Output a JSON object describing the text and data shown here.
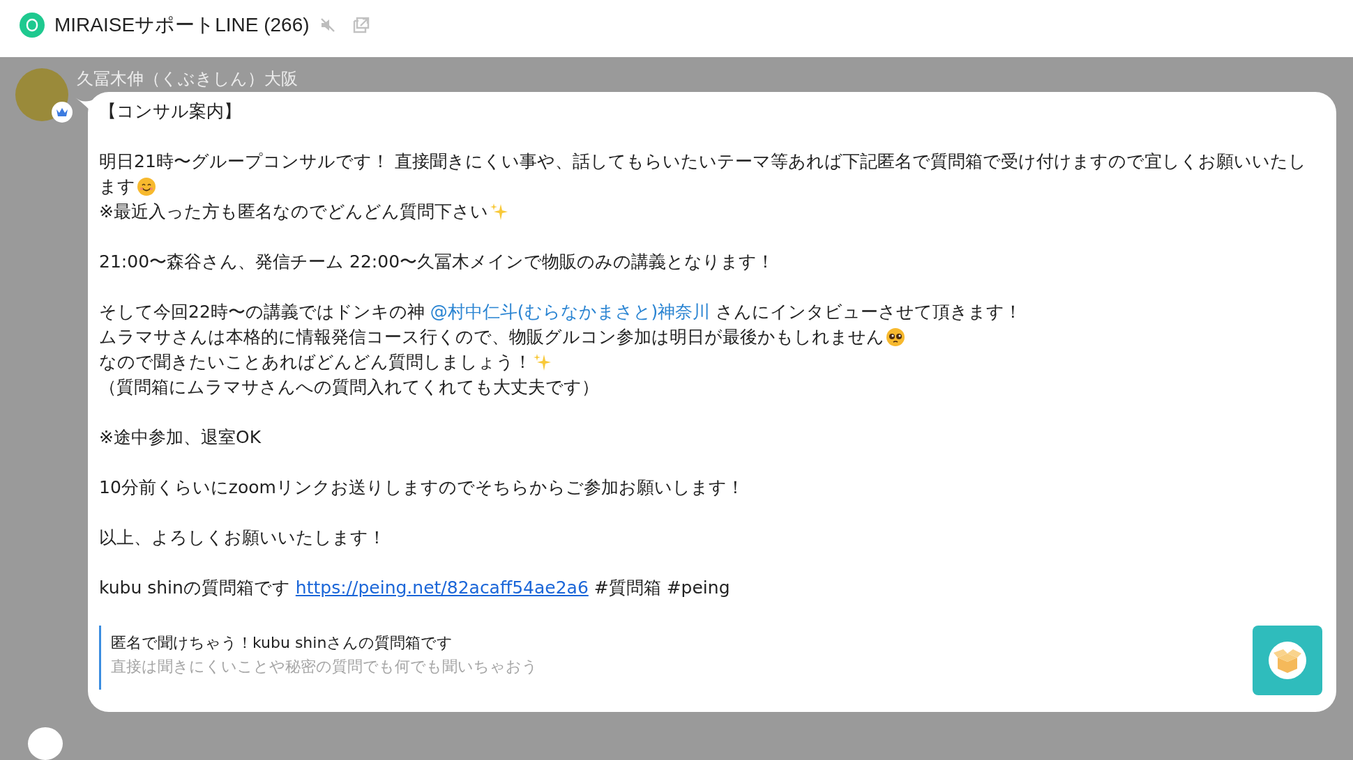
{
  "header": {
    "title": "MIRAISEサポートLINE (266)",
    "muted": true
  },
  "message": {
    "sender": "久冨木伸（くぶきしん）大阪",
    "sender_badge": {
      "kind": "crown"
    },
    "blocks": [
      {
        "lines": [
          [
            {
              "kind": "text",
              "text": "【コンサル案内】"
            }
          ]
        ]
      },
      {
        "lines": [
          [
            {
              "kind": "text",
              "text": "明日21時〜グループコンサルです！ 直接聞きにくい事や、話してもらいたいテーマ等あれば下記匿名で質問箱で受け付けますので宜しくお願いいたし"
            }
          ],
          [
            {
              "kind": "text",
              "text": "ます"
            },
            {
              "kind": "smile"
            }
          ],
          [
            {
              "kind": "text",
              "text": "※最近入った方も匿名なのでどんどん質問下さい"
            },
            {
              "kind": "sparkles"
            }
          ]
        ]
      },
      {
        "lines": [
          [
            {
              "kind": "text",
              "text": "21:00〜森谷さん、発信チーム 22:00〜久冨木メインで物販のみの講義となります！"
            }
          ]
        ]
      },
      {
        "lines": [
          [
            {
              "kind": "text",
              "text": "そして今回22時〜の講義ではドンキの神 "
            },
            {
              "kind": "mention",
              "text": "@村中仁斗(むらなかまさと)神奈川"
            },
            {
              "kind": "text",
              "text": " さんにインタビューさせて頂きます！"
            }
          ],
          [
            {
              "kind": "text",
              "text": "ムラマサさんは本格的に情報発信コース行くので、物販グルコン参加は明日が最後かもしれません"
            },
            {
              "kind": "pleading"
            }
          ],
          [
            {
              "kind": "text",
              "text": "なので聞きたいことあればどんどん質問しましょう！"
            },
            {
              "kind": "sparkles"
            }
          ],
          [
            {
              "kind": "text",
              "text": "（質問箱にムラマサさんへの質問入れてくれても大丈夫です）"
            }
          ]
        ]
      },
      {
        "lines": [
          [
            {
              "kind": "text",
              "text": "※途中参加、退室OK"
            }
          ]
        ]
      },
      {
        "lines": [
          [
            {
              "kind": "text",
              "text": "10分前くらいにzoomリンクお送りしますのでそちらからご参加お願いします！"
            }
          ]
        ]
      },
      {
        "lines": [
          [
            {
              "kind": "text",
              "text": "以上、よろしくお願いいたします！"
            }
          ]
        ]
      },
      {
        "lines": [
          [
            {
              "kind": "text",
              "text": "kubu shinの質問箱です "
            },
            {
              "kind": "link",
              "text": "https://peing.net/82acaff54ae2a6"
            },
            {
              "kind": "text",
              "text": " #質問箱 #peing"
            }
          ]
        ]
      }
    ],
    "link_preview": {
      "title": "匿名で聞けちゃう！kubu shinさんの質問箱です",
      "description": "直接は聞きにくいことや秘密の質問でも何でも聞いちゃおう"
    }
  }
}
